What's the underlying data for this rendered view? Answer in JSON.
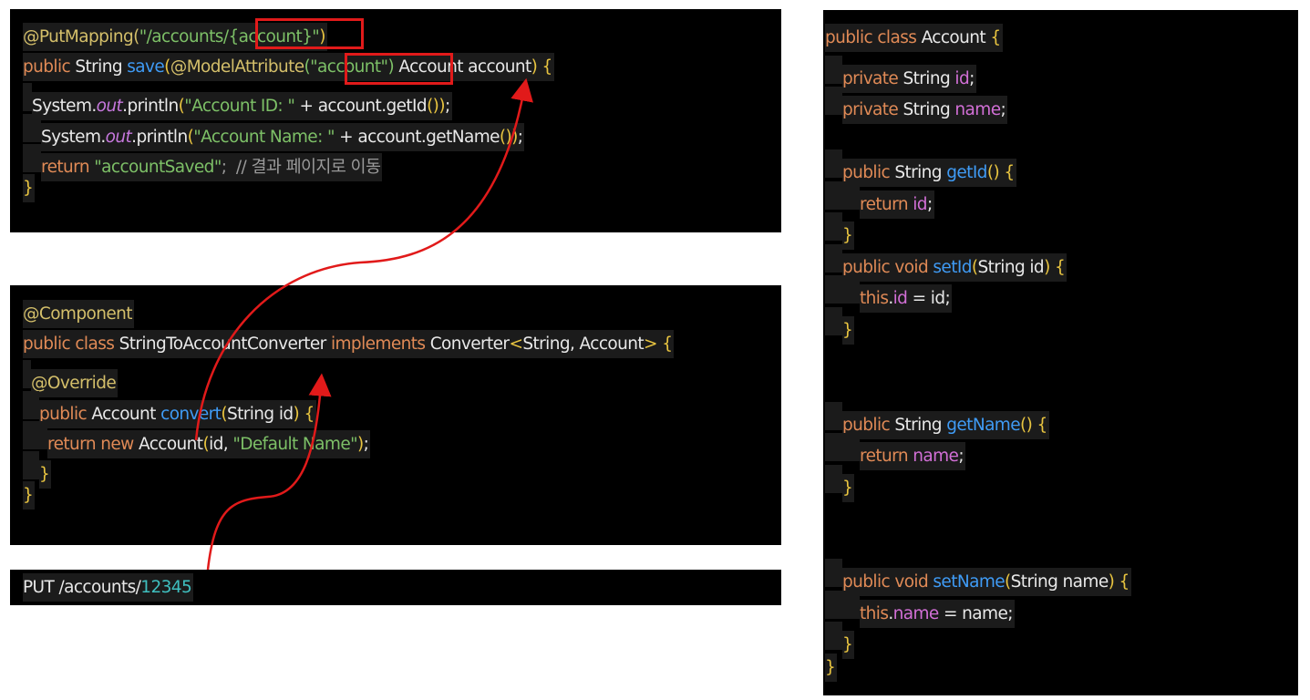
{
  "colors": {
    "annotation": "#d4bf6a",
    "keyword": "#e08a56",
    "plain": "#e8e8e8",
    "method": "#3f9bf5",
    "string": "#7dc067",
    "field": "#d26fd6",
    "bracket": "#e8c440",
    "number": "#3fbfbf",
    "italic": "#c678dd",
    "comment": "#9a9a9a",
    "arrow": "#e11a1a"
  },
  "controller_panel": {
    "lines": [
      {
        "indent": 0,
        "tokens": [
          [
            "@PutMapping(",
            "annotation"
          ],
          [
            "\"/accounts",
            "string"
          ],
          [
            "/{account}\"",
            "string"
          ],
          [
            ")",
            "bracket"
          ]
        ]
      },
      {
        "indent": 0,
        "tokens": [
          [
            "public",
            "keyword"
          ],
          [
            " String ",
            "plain"
          ],
          [
            "save",
            "method"
          ],
          [
            "(",
            "bracket"
          ],
          [
            "@ModelAttribute",
            "annotation"
          ],
          [
            "(\"account\")",
            "string"
          ],
          [
            " Account account",
            "plain"
          ],
          [
            ")",
            "bracket"
          ],
          [
            " {",
            "bracket"
          ]
        ]
      },
      {
        "indent": 1,
        "tokens": [
          [
            "System.",
            "plain"
          ],
          [
            "out",
            "italic"
          ],
          [
            ".println",
            "plain"
          ],
          [
            "(",
            "bracket"
          ],
          [
            "\"Account ID: \"",
            "string"
          ],
          [
            " + account.getId",
            "plain"
          ],
          [
            "()",
            "bracket"
          ],
          [
            ")",
            "bracket"
          ],
          [
            ";",
            "plain"
          ]
        ]
      },
      {
        "indent": 2,
        "tokens": [
          [
            "System.",
            "plain"
          ],
          [
            "out",
            "italic"
          ],
          [
            ".println",
            "plain"
          ],
          [
            "(",
            "bracket"
          ],
          [
            "\"Account Name: \"",
            "string"
          ],
          [
            " + account.getName",
            "plain"
          ],
          [
            "()",
            "bracket"
          ],
          [
            ")",
            "bracket"
          ],
          [
            ";",
            "plain"
          ]
        ]
      },
      {
        "indent": 2,
        "tokens": [
          [
            "return ",
            "keyword"
          ],
          [
            "\"accountSaved\"",
            "string"
          ],
          [
            ";  // 결과 페이지로 이동",
            "comment"
          ]
        ]
      },
      {
        "indent": 0,
        "tokens": [
          [
            "}",
            "bracket"
          ]
        ]
      }
    ]
  },
  "converter_panel": {
    "lines": [
      {
        "indent": 0,
        "tokens": [
          [
            "@Component",
            "annotation"
          ]
        ]
      },
      {
        "indent": 0,
        "tokens": [
          [
            "public class ",
            "keyword"
          ],
          [
            "StringToAccountConverter ",
            "plain"
          ],
          [
            "implements ",
            "keyword"
          ],
          [
            "Converter",
            "plain"
          ],
          [
            "<",
            "bracket"
          ],
          [
            "String, Account",
            "plain"
          ],
          [
            ">",
            "bracket"
          ],
          [
            " {",
            "bracket"
          ]
        ]
      },
      {
        "indent": 1,
        "tokens": [
          [
            "@Override",
            "annotation"
          ]
        ]
      },
      {
        "indent": 2,
        "tokens": [
          [
            "public ",
            "keyword"
          ],
          [
            "Account ",
            "plain"
          ],
          [
            "convert",
            "method"
          ],
          [
            "(",
            "bracket"
          ],
          [
            "String id",
            "plain"
          ],
          [
            ")",
            "bracket"
          ],
          [
            " {",
            "bracket"
          ]
        ]
      },
      {
        "indent": 3,
        "tokens": [
          [
            "return new ",
            "keyword"
          ],
          [
            "Account",
            "plain"
          ],
          [
            "(",
            "bracket"
          ],
          [
            "id, ",
            "plain"
          ],
          [
            "\"Default Name\"",
            "string"
          ],
          [
            ")",
            "bracket"
          ],
          [
            ";",
            "plain"
          ]
        ]
      },
      {
        "indent": 2,
        "tokens": [
          [
            "}",
            "bracket"
          ]
        ]
      },
      {
        "indent": 0,
        "tokens": [
          [
            "}",
            "bracket"
          ]
        ]
      }
    ]
  },
  "request_panel": {
    "lines": [
      {
        "indent": 0,
        "tokens": [
          [
            "PUT /accounts/",
            "plain"
          ],
          [
            "12345",
            "number"
          ]
        ]
      }
    ]
  },
  "account_panel": {
    "lines": [
      {
        "indent": 0,
        "tokens": [
          [
            "public class ",
            "keyword"
          ],
          [
            "Account ",
            "plain"
          ],
          [
            "{",
            "bracket"
          ]
        ]
      },
      {
        "indent": 1,
        "tokens": [
          [
            "private ",
            "keyword"
          ],
          [
            "String ",
            "plain"
          ],
          [
            "id",
            "field"
          ],
          [
            ";",
            "plain"
          ]
        ]
      },
      {
        "indent": 1,
        "tokens": [
          [
            "private ",
            "keyword"
          ],
          [
            "String ",
            "plain"
          ],
          [
            "name",
            "field"
          ],
          [
            ";",
            "plain"
          ]
        ]
      },
      {
        "indent": 0,
        "tokens": []
      },
      {
        "indent": 1,
        "tokens": [
          [
            "public ",
            "keyword"
          ],
          [
            "String ",
            "plain"
          ],
          [
            "getId",
            "method"
          ],
          [
            "()",
            "bracket"
          ],
          [
            " {",
            "bracket"
          ]
        ]
      },
      {
        "indent": 2,
        "tokens": [
          [
            "return ",
            "keyword"
          ],
          [
            "id",
            "field"
          ],
          [
            ";",
            "plain"
          ]
        ]
      },
      {
        "indent": 1,
        "tokens": [
          [
            "}",
            "bracket"
          ]
        ]
      },
      {
        "indent": 1,
        "tokens": [
          [
            "public void ",
            "keyword"
          ],
          [
            "setId",
            "method"
          ],
          [
            "(",
            "bracket"
          ],
          [
            "String id",
            "plain"
          ],
          [
            ")",
            "bracket"
          ],
          [
            " {",
            "bracket"
          ]
        ]
      },
      {
        "indent": 2,
        "tokens": [
          [
            "this",
            "keyword"
          ],
          [
            ".",
            "plain"
          ],
          [
            "id",
            "field"
          ],
          [
            " = id;",
            "plain"
          ]
        ]
      },
      {
        "indent": 1,
        "tokens": [
          [
            "}",
            "bracket"
          ]
        ]
      },
      {
        "indent": 0,
        "tokens": []
      },
      {
        "indent": 0,
        "tokens": []
      },
      {
        "indent": 1,
        "tokens": [
          [
            "public ",
            "keyword"
          ],
          [
            "String ",
            "plain"
          ],
          [
            "getName",
            "method"
          ],
          [
            "()",
            "bracket"
          ],
          [
            " {",
            "bracket"
          ]
        ]
      },
      {
        "indent": 2,
        "tokens": [
          [
            "return ",
            "keyword"
          ],
          [
            "name",
            "field"
          ],
          [
            ";",
            "plain"
          ]
        ]
      },
      {
        "indent": 1,
        "tokens": [
          [
            "}",
            "bracket"
          ]
        ]
      },
      {
        "indent": 0,
        "tokens": []
      },
      {
        "indent": 0,
        "tokens": []
      },
      {
        "indent": 1,
        "tokens": [
          [
            "public void ",
            "keyword"
          ],
          [
            "setName",
            "method"
          ],
          [
            "(",
            "bracket"
          ],
          [
            "String name",
            "plain"
          ],
          [
            ")",
            "bracket"
          ],
          [
            " {",
            "bracket"
          ]
        ]
      },
      {
        "indent": 2,
        "tokens": [
          [
            "this",
            "keyword"
          ],
          [
            ".",
            "plain"
          ],
          [
            "name",
            "field"
          ],
          [
            " = name;",
            "plain"
          ]
        ]
      },
      {
        "indent": 1,
        "tokens": [
          [
            "}",
            "bracket"
          ]
        ]
      },
      {
        "indent": 0,
        "tokens": [
          [
            "}",
            "bracket"
          ]
        ]
      }
    ]
  }
}
